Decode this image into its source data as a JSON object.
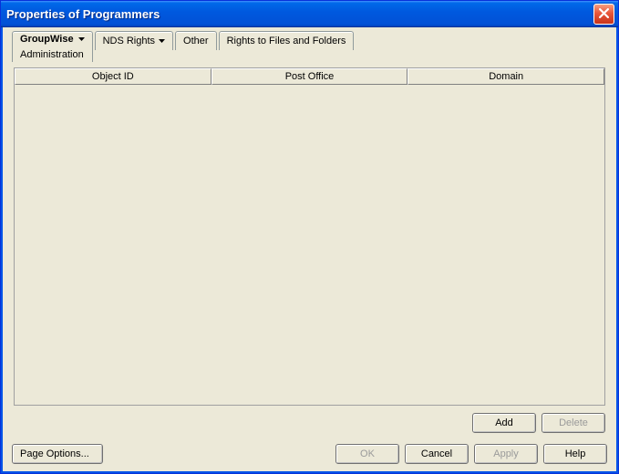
{
  "window": {
    "title": "Properties of Programmers"
  },
  "tabs": {
    "active": {
      "label": "GroupWise",
      "sub": "Administration"
    },
    "t1": {
      "label": "NDS Rights"
    },
    "t2": {
      "label": "Other"
    },
    "t3": {
      "label": "Rights to Files and Folders"
    }
  },
  "table": {
    "columns": {
      "c0": "Object ID",
      "c1": "Post Office",
      "c2": "Domain"
    },
    "rows": []
  },
  "buttons": {
    "add": "Add",
    "delete": "Delete",
    "page_options": "Page Options...",
    "ok": "OK",
    "cancel": "Cancel",
    "apply": "Apply",
    "help": "Help"
  }
}
